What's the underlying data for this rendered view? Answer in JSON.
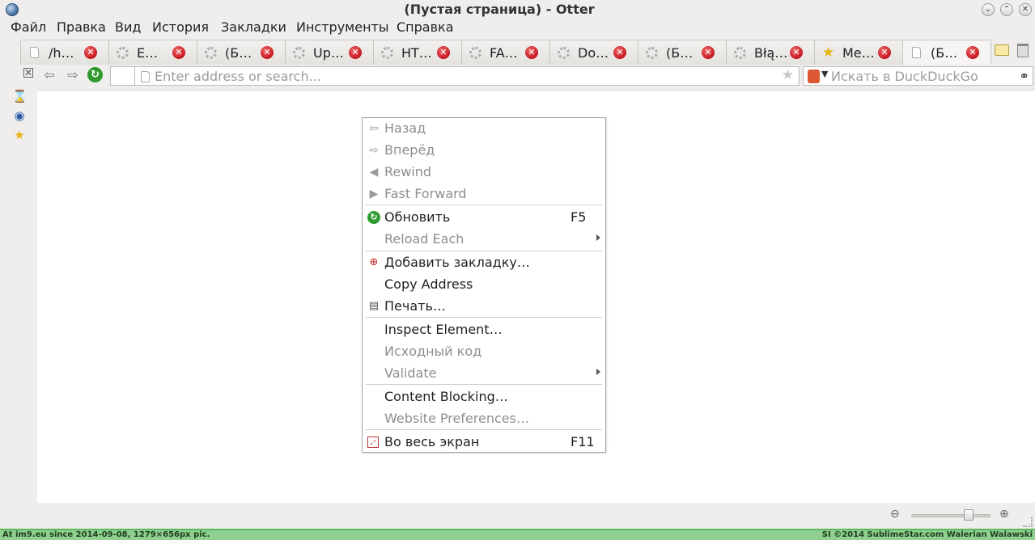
{
  "window": {
    "title": "(Пустая страница) - Otter"
  },
  "menubar": [
    "Файл",
    "Правка",
    "Вид",
    "История",
    "Закладки",
    "Инструменты",
    "Справка"
  ],
  "tabs": [
    {
      "label": "/h…",
      "icon": "document-icon"
    },
    {
      "label": "E…",
      "icon": "loading-icon"
    },
    {
      "label": "(Б…",
      "icon": "loading-icon"
    },
    {
      "label": "Up…",
      "icon": "loading-icon"
    },
    {
      "label": "HT…",
      "icon": "loading-icon"
    },
    {
      "label": "FA…",
      "icon": "loading-icon"
    },
    {
      "label": "Do…",
      "icon": "loading-icon"
    },
    {
      "label": "(Б…",
      "icon": "loading-icon"
    },
    {
      "label": "Błą…",
      "icon": "loading-icon"
    },
    {
      "label": "Me…",
      "icon": "star-icon"
    },
    {
      "label": "(Б…",
      "icon": "document-icon",
      "active": true
    }
  ],
  "addressbar": {
    "placeholder": "Enter address or search...",
    "value": ""
  },
  "searchbar": {
    "placeholder": "Искать в DuckDuckGo",
    "engine_icon": "duckduckgo-icon"
  },
  "context_menu": {
    "items": [
      {
        "label": "Назад",
        "enabled": false,
        "icon": "back-arrow-icon"
      },
      {
        "label": "Вперёд",
        "enabled": false,
        "icon": "forward-arrow-icon"
      },
      {
        "label": "Rewind",
        "enabled": false,
        "icon": "rewind-icon"
      },
      {
        "label": "Fast Forward",
        "enabled": false,
        "icon": "fast-forward-icon"
      },
      {
        "label": "Обновить",
        "enabled": true,
        "icon": "reload-icon",
        "shortcut": "F5"
      },
      {
        "label": "Reload Each",
        "enabled": false,
        "submenu": true
      },
      {
        "label": "Добавить закладку…",
        "enabled": true,
        "icon": "bookmark-add-icon"
      },
      {
        "label": "Copy Address",
        "enabled": true
      },
      {
        "label": "Печать…",
        "enabled": true,
        "icon": "printer-icon"
      },
      {
        "label": "Inspect Element…",
        "enabled": true
      },
      {
        "label": "Исходный код",
        "enabled": false
      },
      {
        "label": "Validate",
        "enabled": false,
        "submenu": true
      },
      {
        "label": "Content Blocking…",
        "enabled": true
      },
      {
        "label": "Website Preferences…",
        "enabled": false
      },
      {
        "label": "Во весь экран",
        "enabled": true,
        "icon": "fullscreen-icon",
        "shortcut": "F11"
      }
    ]
  },
  "statusbar": {
    "zoom_level": 0.75
  },
  "watermark": {
    "left_text": "At im9.eu since 2014-09-08, 1279×656px pic.",
    "right_text": "SI ©2014 SublimeStar.com Walerian Walawski"
  },
  "colors": {
    "close_tab": "#c4161c",
    "reload_green": "#2f9a2f",
    "watermark_bg": "#8fcf8f"
  }
}
